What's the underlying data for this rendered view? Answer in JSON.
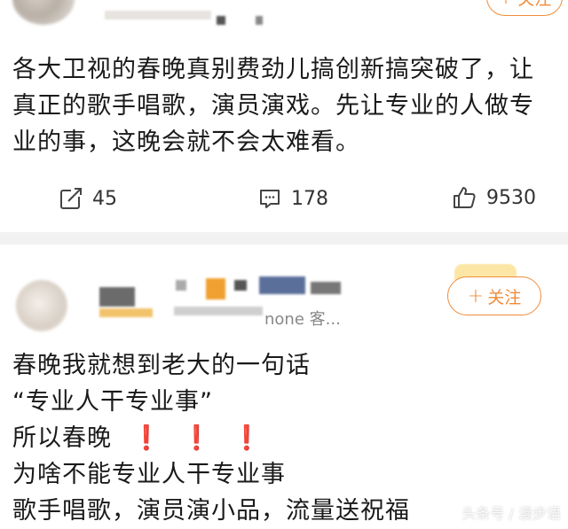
{
  "post1": {
    "follow_label": "关注",
    "content": "各大卫视的春晚真别费劲儿搞创新搞突破了，让真正的歌手唱歌，演员演戏。先让专业的人做专业的事，这晚会就不会太难看。",
    "repost_count": "45",
    "comment_count": "178",
    "like_count": "9530",
    "icons": {
      "repost": "share-icon",
      "comment": "comment-icon",
      "like": "like-icon"
    }
  },
  "post2": {
    "follow_label": "关注",
    "meta_text": "none 客...",
    "lines": [
      "春晚我就想到老大的一句话",
      "“专业人干专业事”",
      "所以春晚",
      "为啥不能专业人干专业事",
      "歌手唱歌，演员演小品，流量送祝福"
    ],
    "marks": [
      "❗",
      "❗",
      "❗"
    ]
  },
  "watermark": "头条号 / 漫步语",
  "colors": {
    "accent": "#f08c3a",
    "divider": "#f2f2f2",
    "alert": "#e02020"
  }
}
